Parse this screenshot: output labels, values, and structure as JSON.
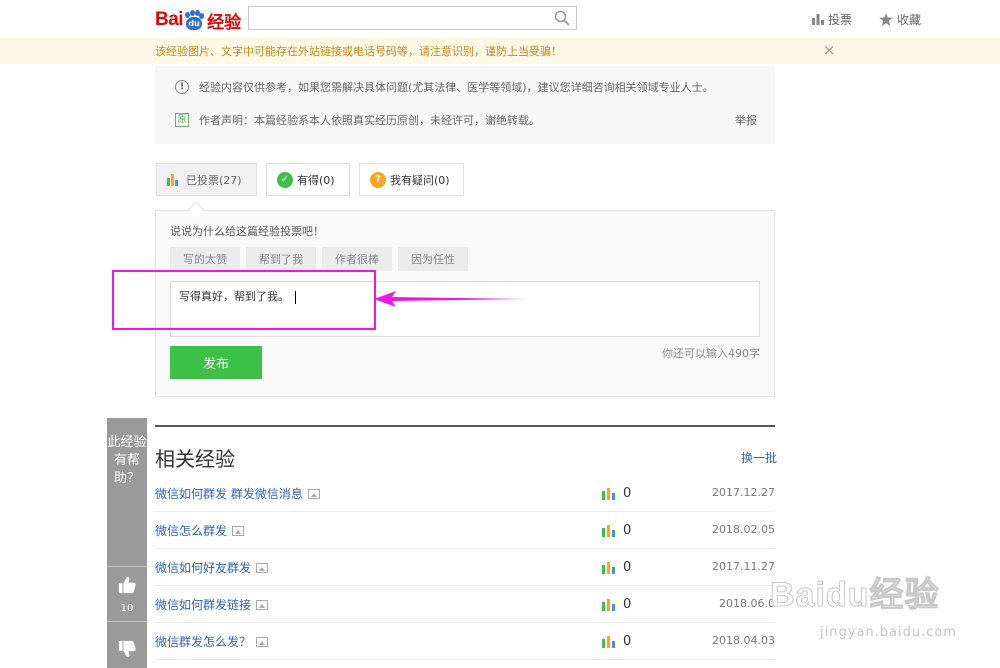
{
  "header": {
    "logo_bai": "Bai",
    "logo_du": "du",
    "logo_jingyan": "经验",
    "vote_label": "投票",
    "favorite_label": "收藏"
  },
  "notice": {
    "text": "该经验图片、文字中可能存在外站链接或电话号码等，请注意识别，谨防上当受骗！",
    "close": "×"
  },
  "info": {
    "disclaimer": "经验内容仅供参考，如果您需解决具体问题(尤其法律、医学等领域)，建议您详细咨询相关领域专业人士。",
    "original_badge": "原",
    "author_statement": "作者声明：本篇经验系本人依照真实经历原创，未经许可，谢绝转载。",
    "report": "举报"
  },
  "vote_tabs": [
    {
      "label": "已投票(27)"
    },
    {
      "label": "有得(0)",
      "icon_color": "#3cc146",
      "icon_glyph": "✓"
    },
    {
      "label": "我有疑问(0)",
      "icon_color": "#f5a623",
      "icon_glyph": "?"
    }
  ],
  "comment": {
    "prompt": "说说为什么给这篇经验投票吧！",
    "chips": [
      "写的太赞",
      "帮到了我",
      "作者很棒",
      "因为任性"
    ],
    "text": "写得真好，帮到了我。",
    "remaining": "你还可以输入490字",
    "publish": "发布"
  },
  "related": {
    "title": "相关经验",
    "refresh": "换一批",
    "rows": [
      {
        "title": "微信如何群发 群发微信消息",
        "count": "0",
        "date": "2017.12.27"
      },
      {
        "title": "微信怎么群发",
        "count": "0",
        "date": "2018.02.05"
      },
      {
        "title": "微信如何好友群发",
        "count": "0",
        "date": "2017.11.27"
      },
      {
        "title": "微信如何群发链接",
        "count": "0",
        "date": "2018.06.0"
      },
      {
        "title": "微信群发怎么发？",
        "count": "0",
        "date": "2018.04.03"
      }
    ]
  },
  "side_help": {
    "text": "此经验有帮助？",
    "like_count": "10"
  },
  "watermark": {
    "main": "Baidu经验",
    "sub": "jingyan.baidu.com"
  },
  "colors": {
    "accent_green": "#3cc146",
    "link_blue": "#2d64b3",
    "annotation_magenta": "#f016e6",
    "notice_text": "#c8871f",
    "brand_red": "#e10601"
  }
}
